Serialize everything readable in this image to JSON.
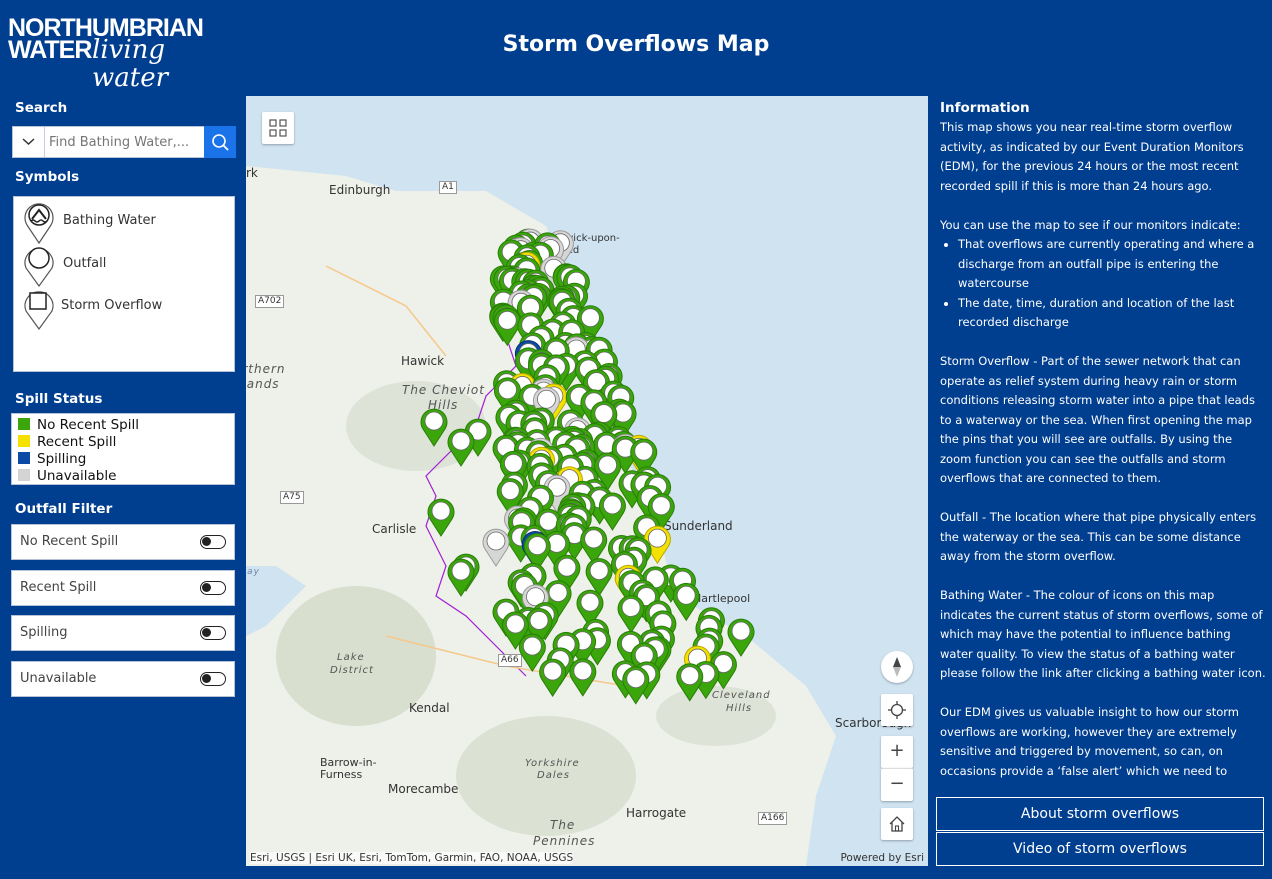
{
  "header": {
    "logo_line1": "NORTHUMBRIAN",
    "logo_line2": "WATER",
    "logo_script": "living water",
    "title": "Storm Overflows Map"
  },
  "sidebar": {
    "search_title": "Search",
    "search_placeholder": "Find Bathing Water,...",
    "symbols_title": "Symbols",
    "symbols": [
      {
        "label": "Bathing Water",
        "icon": "bathing-water-pin-icon"
      },
      {
        "label": "Outfall",
        "icon": "outfall-pin-icon"
      },
      {
        "label": "Storm Overflow",
        "icon": "storm-overflow-pin-icon"
      }
    ],
    "spill_title": "Spill Status",
    "spill_status": [
      {
        "label": "No Recent Spill",
        "color": "#3aa60c"
      },
      {
        "label": "Recent Spill",
        "color": "#f5e100"
      },
      {
        "label": "Spilling",
        "color": "#0b4aa6"
      },
      {
        "label": "Unavailable",
        "color": "#d4d4d4"
      }
    ],
    "filter_title": "Outfall Filter",
    "filters": [
      {
        "label": "No Recent Spill"
      },
      {
        "label": "Recent Spill"
      },
      {
        "label": "Spilling"
      },
      {
        "label": "Unavailable"
      }
    ]
  },
  "map": {
    "places": {
      "edinburgh": "Edinburgh",
      "berwick1": "Berwick-upon-",
      "berwick2": "Tweed",
      "hawick": "Hawick",
      "cheviot1": "The Cheviot",
      "cheviot2": "Hills",
      "northern1": "Northern",
      "northern2": "Uplands",
      "carlisle": "Carlisle",
      "sunderland": "Sunderland",
      "hartlepool": "Hartlepool",
      "lake1": "Lake",
      "lake2": "District",
      "kendal": "Kendal",
      "cleveland1": "Cleveland",
      "cleveland2": "Hills",
      "scarborough": "Scarborough",
      "barrow1": "Barrow-in-",
      "barrow2": "Furness",
      "yorkshire1": "Yorkshire",
      "yorkshire2": "Dales",
      "morecambe": "Morecambe",
      "harrogate": "Harrogate",
      "pennines1": "The",
      "pennines2": "Pennines",
      "edge_k": "rk",
      "solway": "Solway"
    },
    "roads": [
      "A1",
      "A702",
      "A75",
      "A66",
      "A166"
    ],
    "attribution": "Esri, USGS | Esri UK, Esri, TomTom, Garmin, FAO, NOAA, USGS",
    "powered_by": "Powered by Esri",
    "controls": {
      "zoom_in": "+",
      "zoom_out": "−"
    }
  },
  "info": {
    "title": "Information",
    "p1": "This map shows you near real-time storm overflow activity, as indicated by our Event Duration Monitors (EDM), for the previous 24 hours or the most recent recorded spill if this is more than 24 hours ago.",
    "p2": "You can use the map to see if our monitors indicate:",
    "bullets": [
      "That overflows are currently operating and where a discharge from an outfall pipe is entering the watercourse",
      "The date, time, duration and location of the last recorded discharge"
    ],
    "p3": "Storm Overflow - Part of the sewer network that can operate as relief system during heavy rain or storm conditions releasing storm water into a pipe that leads to a waterway or the sea. When first opening the map the pins that you will see are outfalls. By using the zoom function you can see the outfalls and storm overflows that are connected to them.",
    "p4": "Outfall - The location where that pipe physically enters the waterway or the sea. This can be some distance away from the storm overflow.",
    "p5": "Bathing Water - The colour of icons on this map indicates the current status of storm overflows, some of which may have the potential to influence bathing water quality. To view the status of a bathing water please follow the link after clicking a bathing water icon.",
    "p6": "Our EDM gives us valuable insight to how our storm overflows are working, however they are extremely sensitive and triggered by movement, so can, on occasions provide a ‘false alert’ which we need to validate.",
    "btn_about": "About storm overflows",
    "btn_video": "Video of storm overflows"
  }
}
